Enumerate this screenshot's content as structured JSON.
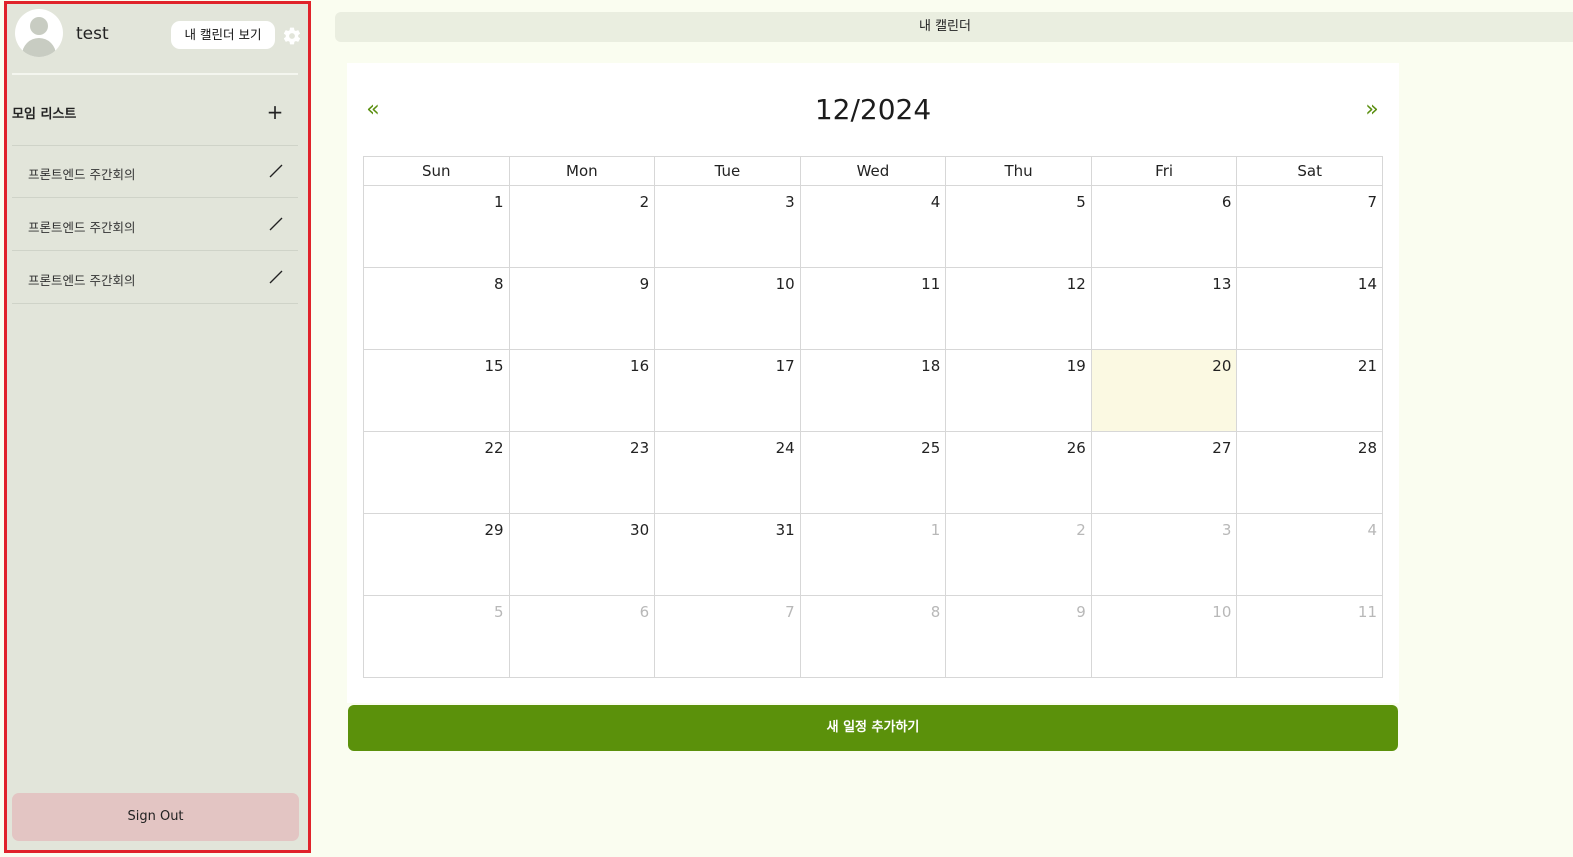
{
  "sidebar": {
    "username": "test",
    "my_calendar_button": "내 캘린더 보기",
    "group_list_title": "모임 리스트",
    "add_group_symbol": "+",
    "groups": [
      {
        "label": "프론트엔드 주간회의"
      },
      {
        "label": "프론트엔드 주간회의"
      },
      {
        "label": "프론트엔드 주간회의"
      }
    ],
    "sign_out_label": "Sign Out"
  },
  "topbar": {
    "title": "내 캘린더"
  },
  "calendar": {
    "prev_symbol": "«",
    "next_symbol": "»",
    "month_title": "12/2024",
    "weekdays": [
      "Sun",
      "Mon",
      "Tue",
      "Wed",
      "Thu",
      "Fri",
      "Sat"
    ],
    "weeks": [
      [
        {
          "day": "1"
        },
        {
          "day": "2"
        },
        {
          "day": "3"
        },
        {
          "day": "4"
        },
        {
          "day": "5"
        },
        {
          "day": "6"
        },
        {
          "day": "7"
        }
      ],
      [
        {
          "day": "8"
        },
        {
          "day": "9"
        },
        {
          "day": "10"
        },
        {
          "day": "11"
        },
        {
          "day": "12"
        },
        {
          "day": "13"
        },
        {
          "day": "14"
        }
      ],
      [
        {
          "day": "15"
        },
        {
          "day": "16"
        },
        {
          "day": "17"
        },
        {
          "day": "18"
        },
        {
          "day": "19"
        },
        {
          "day": "20",
          "today": true
        },
        {
          "day": "21"
        }
      ],
      [
        {
          "day": "22"
        },
        {
          "day": "23"
        },
        {
          "day": "24"
        },
        {
          "day": "25"
        },
        {
          "day": "26"
        },
        {
          "day": "27"
        },
        {
          "day": "28"
        }
      ],
      [
        {
          "day": "29"
        },
        {
          "day": "30"
        },
        {
          "day": "31"
        },
        {
          "day": "1",
          "other": true
        },
        {
          "day": "2",
          "other": true
        },
        {
          "day": "3",
          "other": true
        },
        {
          "day": "4",
          "other": true
        }
      ],
      [
        {
          "day": "5",
          "other": true
        },
        {
          "day": "6",
          "other": true
        },
        {
          "day": "7",
          "other": true
        },
        {
          "day": "8",
          "other": true
        },
        {
          "day": "9",
          "other": true
        },
        {
          "day": "10",
          "other": true
        },
        {
          "day": "11",
          "other": true
        }
      ]
    ]
  },
  "add_event_button": "새 일정 추가하기",
  "colors": {
    "accent_green": "#5b910b",
    "sidebar_bg": "#e2e5da",
    "sidebar_border": "#e0222a",
    "sign_out_bg": "#e3c5c3",
    "today_bg": "#fbf9e2",
    "page_bg": "#fafdf0"
  },
  "icons": {
    "avatar": "user-avatar-icon",
    "settings": "gear-icon",
    "add": "plus-icon",
    "edit": "pencil-icon",
    "prev": "double-chevron-left-icon",
    "next": "double-chevron-right-icon"
  }
}
